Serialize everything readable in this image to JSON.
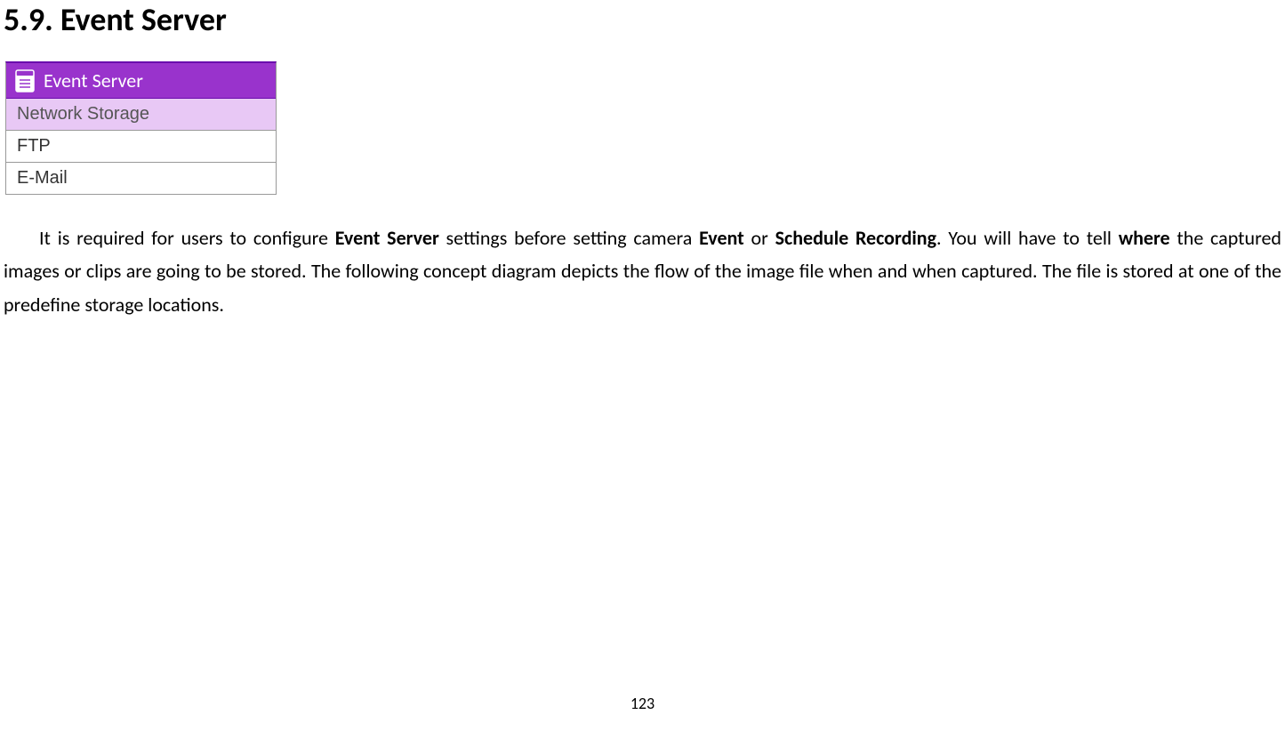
{
  "heading": "5.9.  Event Server",
  "menu": {
    "header": "Event Server",
    "items": [
      {
        "label": "Network Storage",
        "selected": true
      },
      {
        "label": "FTP",
        "selected": false
      },
      {
        "label": "E-Mail",
        "selected": false
      }
    ]
  },
  "paragraph": {
    "t1": "It is required for users to configure ",
    "b1": "Event Server",
    "t2": " settings before setting camera ",
    "b2": "Event",
    "t3": " or ",
    "b3": "Schedule Recording",
    "t4": ". You will have to tell ",
    "b4": "where",
    "t5": " the captured images or clips are going to be stored. The following concept diagram depicts the flow of the image file when and when captured. The file is stored at one of the predefine storage locations."
  },
  "pageNumber": "123"
}
